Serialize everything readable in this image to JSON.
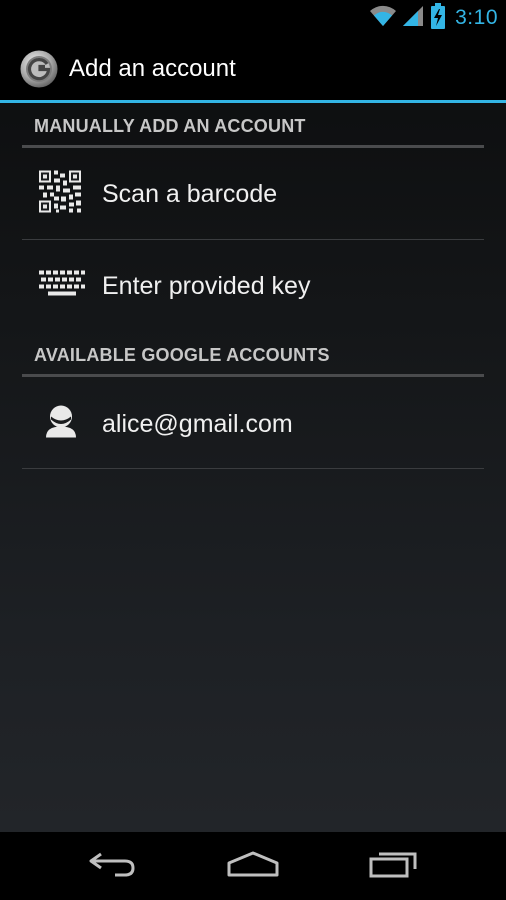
{
  "status_bar": {
    "time": "3:10",
    "icons": [
      "wifi-icon",
      "signal-icon",
      "battery-charging-icon"
    ],
    "accent_color": "#33b5e5"
  },
  "action_bar": {
    "title": "Add an account",
    "icon": "authenticator-app-icon",
    "accent_color": "#33b5e5"
  },
  "sections": {
    "manual": {
      "header": "MANUALLY ADD AN ACCOUNT",
      "items": [
        {
          "label": "Scan a barcode",
          "icon": "qr-code-icon"
        },
        {
          "label": "Enter provided key",
          "icon": "keyboard-icon"
        }
      ]
    },
    "google": {
      "header": "AVAILABLE GOOGLE ACCOUNTS",
      "items": [
        {
          "label": "alice@gmail.com",
          "icon": "person-icon"
        }
      ]
    }
  },
  "nav_bar": {
    "buttons": [
      "back-icon",
      "home-icon",
      "recent-apps-icon"
    ]
  }
}
